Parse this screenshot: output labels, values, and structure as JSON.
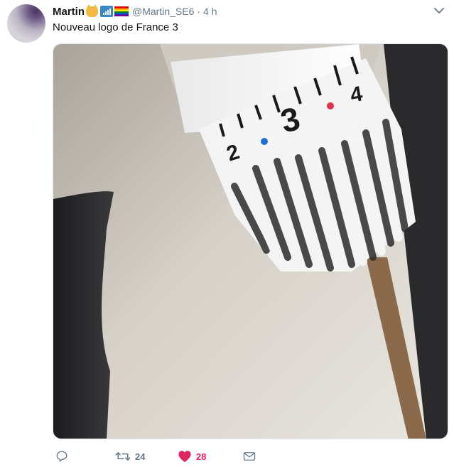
{
  "tweet": {
    "author": {
      "name": "Martin",
      "handle": "@Martin_SE6",
      "name_emojis": [
        "cat-face-icon",
        "signal-bars-icon",
        "rainbow-flag-icon"
      ]
    },
    "separator": "·",
    "timestamp": "4 h",
    "text": "Nouveau logo de France 3",
    "media": {
      "description_icon": "photo",
      "dial_labels": [
        "2",
        "3",
        "4"
      ],
      "dot_colors": [
        "#1f6fd1",
        "#e0324a"
      ]
    },
    "actions": {
      "reply": {
        "icon": "reply-icon",
        "count": ""
      },
      "retweet": {
        "icon": "retweet-icon",
        "count": "24"
      },
      "like": {
        "icon": "heart-icon",
        "count": "28",
        "liked": true
      },
      "message": {
        "icon": "envelope-icon",
        "count": ""
      }
    }
  },
  "colors": {
    "text_primary": "#14171a",
    "text_secondary": "#657786",
    "like_active": "#e0245e",
    "border": "#e1e8ed"
  }
}
